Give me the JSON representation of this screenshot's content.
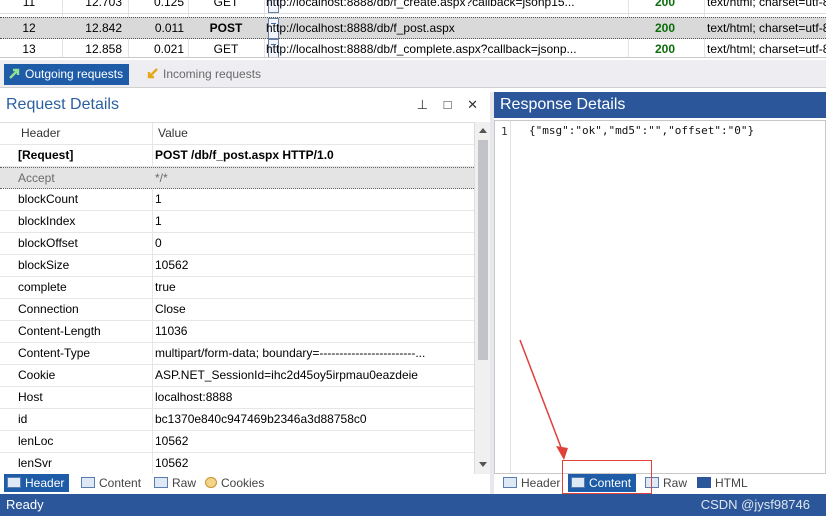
{
  "sessions": {
    "rows": [
      {
        "num": "11",
        "time": "12.703",
        "dur": "0.125",
        "method": "GET",
        "url": "http://localhost:8888/db/f_create.aspx?callback=jsonp15...",
        "status": "200",
        "type": "text/html; charset=utf-8",
        "selected": false
      },
      {
        "num": "12",
        "time": "12.842",
        "dur": "0.011",
        "method": "POST",
        "url": "http://localhost:8888/db/f_post.aspx",
        "status": "200",
        "type": "text/html; charset=utf-8",
        "selected": true
      },
      {
        "num": "13",
        "time": "12.858",
        "dur": "0.021",
        "method": "GET",
        "url": "http://localhost:8888/db/f_complete.aspx?callback=jsonp...",
        "status": "200",
        "type": "text/html; charset=utf-8",
        "selected": false
      }
    ]
  },
  "direction_tabs": {
    "outgoing": "Outgoing requests",
    "incoming": "Incoming requests"
  },
  "request_panel": {
    "title": "Request Details",
    "controls": "⊥ □ ✕",
    "col_header": "Header",
    "col_value": "Value",
    "request_line_key": "[Request]",
    "request_line_value": "POST /db/f_post.aspx HTTP/1.0",
    "rows": [
      {
        "k": "Accept",
        "v": "*/*",
        "selected": true
      },
      {
        "k": "blockCount",
        "v": "1"
      },
      {
        "k": "blockIndex",
        "v": "1"
      },
      {
        "k": "blockOffset",
        "v": "0"
      },
      {
        "k": "blockSize",
        "v": "10562"
      },
      {
        "k": "complete",
        "v": "true"
      },
      {
        "k": "Connection",
        "v": "Close"
      },
      {
        "k": "Content-Length",
        "v": "11036"
      },
      {
        "k": "Content-Type",
        "v": "multipart/form-data; boundary=------------------------..."
      },
      {
        "k": "Cookie",
        "v": "ASP.NET_SessionId=ihc2d45oy5irpmau0eazdeie"
      },
      {
        "k": "Host",
        "v": "localhost:8888"
      },
      {
        "k": "id",
        "v": "bc1370e840c947469b2346a3d88758c0"
      },
      {
        "k": "lenLoc",
        "v": "10562"
      },
      {
        "k": "lenSvr",
        "v": "10562"
      }
    ],
    "tabs": [
      "Header",
      "Content",
      "Raw",
      "Cookies"
    ]
  },
  "response_panel": {
    "title": "Response Details",
    "line_number": "1",
    "code": "{\"msg\":\"ok\",\"md5\":\"\",\"offset\":\"0\"}",
    "tabs": [
      "Header",
      "Content",
      "Raw",
      "HTML"
    ]
  },
  "status_bar": {
    "text": "Ready",
    "watermark": "CSDN @jysf98746"
  },
  "colors": {
    "accent": "#2b579a",
    "tab_active": "#1f5ca8",
    "status_ok": "#0a6d0a",
    "annotation_red": "#e0403a"
  }
}
